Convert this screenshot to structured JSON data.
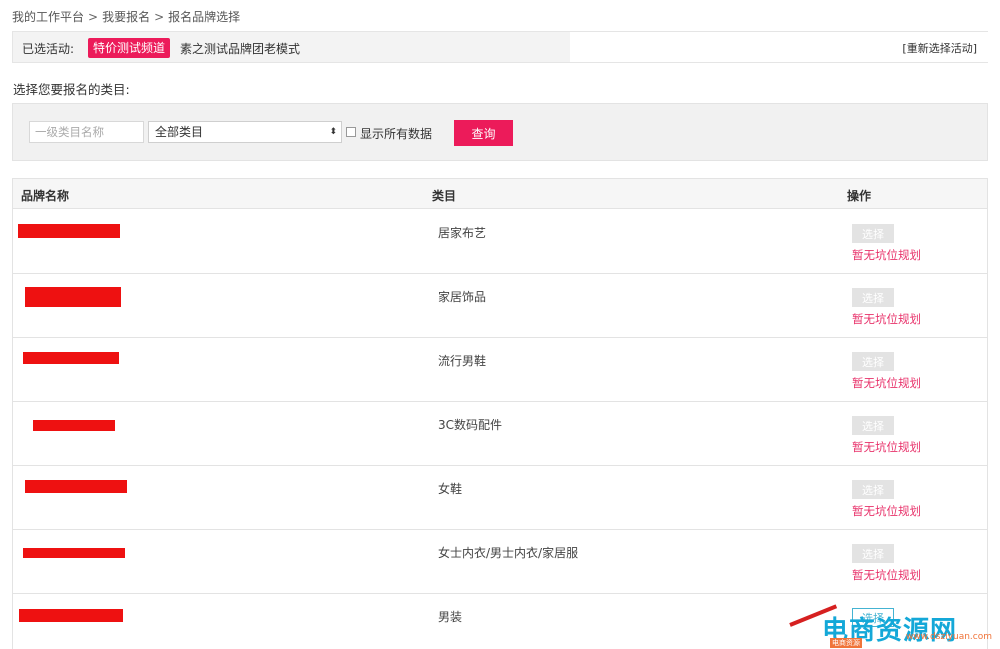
{
  "breadcrumb": {
    "items": [
      "我的工作平台",
      "我要报名",
      "报名品牌选择"
    ],
    "separator": ">"
  },
  "selected_activity": {
    "label": "已选活动:",
    "tag": "特价测试频道",
    "name": "素之测试品牌团老模式",
    "reselect": "[重新选择活动]"
  },
  "section_title": "选择您要报名的类目:",
  "filter": {
    "category_input_placeholder": "一级类目名称",
    "category_select_value": "全部类目",
    "show_all_label": "显示所有数据",
    "query_label": "查询"
  },
  "table": {
    "headers": [
      "品牌名称",
      "类目",
      "操作"
    ],
    "rows": [
      {
        "category": "居家布艺",
        "action_label": "选择",
        "status": "暂无坑位规划"
      },
      {
        "category": "家居饰品",
        "action_label": "选择",
        "status": "暂无坑位规划"
      },
      {
        "category": "流行男鞋",
        "action_label": "选择",
        "status": "暂无坑位规划"
      },
      {
        "category": "3C数码配件",
        "action_label": "选择",
        "status": "暂无坑位规划"
      },
      {
        "category": "女鞋",
        "action_label": "选择",
        "status": "暂无坑位规划"
      },
      {
        "category": "女士内衣/男士内衣/家居服",
        "action_label": "选择",
        "status": "暂无坑位规划"
      },
      {
        "category": "男装",
        "action_label": "选择",
        "status": ""
      }
    ]
  },
  "watermark": {
    "main": "电商资源网",
    "url": "www.dsziyuan.com",
    "badge": "电商资源"
  },
  "colors": {
    "accent": "#ec1b5a",
    "redact": "#ee1111",
    "status_text": "#e8336b",
    "watermark_blue": "#14a8d8"
  }
}
